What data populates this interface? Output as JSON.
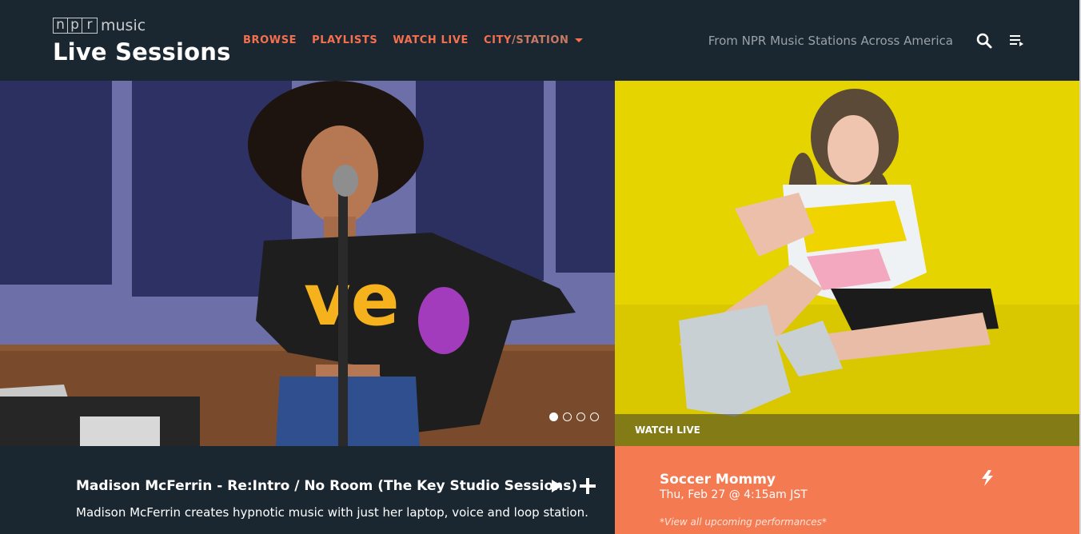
{
  "brand": {
    "npr_letters": [
      "n",
      "p",
      "r"
    ],
    "music": "music",
    "title": "Live Sessions"
  },
  "nav": {
    "browse": "BROWSE",
    "playlists": "PLAYLISTS",
    "watch_live": "WATCH LIVE",
    "city": "CITY",
    "slash": "/",
    "station": "STATION"
  },
  "header": {
    "tagline": "From NPR Music Stations Across America",
    "icons": [
      "search-icon",
      "queue-icon"
    ]
  },
  "carousel": {
    "slide_count": 4,
    "active_index": 0
  },
  "feature": {
    "title": "Madison McFerrin - Re:Intro / No Room (The Key Studio Sessions)",
    "description": "Madison McFerrin creates hypnotic music with just her laptop, voice and loop station."
  },
  "live": {
    "watch_label": "WATCH LIVE",
    "artist": "Soccer Mommy",
    "time": "Thu, Feb 27 @ 4:15am JST",
    "upcoming_link": "*View all upcoming performances*"
  },
  "colors": {
    "header_bg": "#1b2730",
    "accent": "#f4704f",
    "live_panel": "#f47a52",
    "hero_right_bg": "#e6d300"
  }
}
